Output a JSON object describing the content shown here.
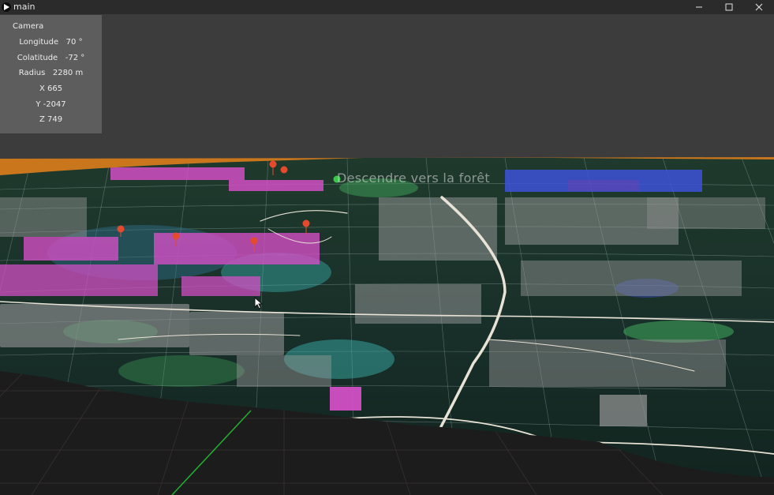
{
  "window": {
    "title": "main",
    "icon": "play-icon",
    "controls": [
      "minimize-icon",
      "maximize-icon",
      "close-icon"
    ]
  },
  "camera_panel": {
    "heading": "Camera",
    "longitude": "Longitude   70 °",
    "colatitude": "Colatitude   -72 °",
    "radius": "Radius   2280 m",
    "x": "X 665",
    "y": "Y -2047",
    "z": "Z 749"
  },
  "scene": {
    "overlay_label": "Descendre vers la forêt",
    "colors": {
      "background": "#3c3c3c",
      "ground_grid": "#1e1e1e",
      "terrain_orange": "#c9761c",
      "buildings_gray": "#9a9a9a",
      "buildings_magenta": "#d24fc4",
      "buildings_blue": "#3d52d8",
      "marker_red": "#e64a2c",
      "marker_green": "#38c84a",
      "vegetation_green": "#3fa35a",
      "water_cyan": "#3fc6c0",
      "road_white": "#e8e3d6",
      "axis_green": "#22b030"
    }
  }
}
